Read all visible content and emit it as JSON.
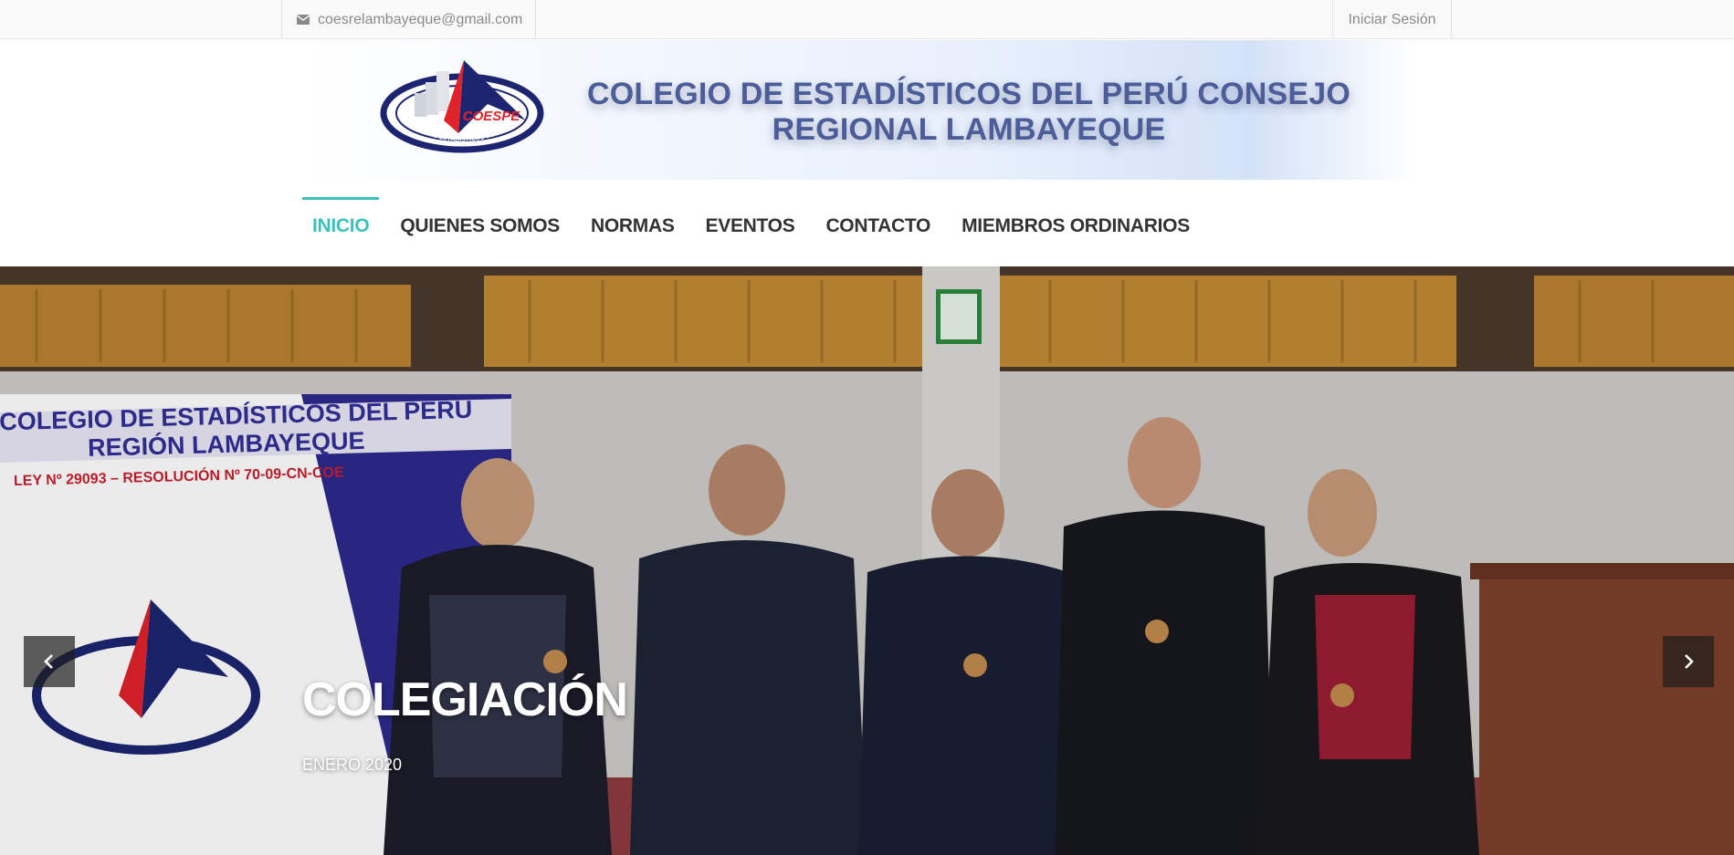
{
  "topbar": {
    "email": "coesrelambayeque@gmail.com",
    "email_icon": "envelope-icon",
    "login": "Iniciar Sesión"
  },
  "header": {
    "logo_text": "COESPE",
    "logo_ring_text": "COLEGIO DE ESTADÍSTICOS DEL PERÚ",
    "title_line1": "COLEGIO DE ESTADÍSTICOS DEL PERÚ CONSEJO",
    "title_line2": "REGIONAL LAMBAYEQUE"
  },
  "nav": {
    "items": [
      {
        "label": "INICIO",
        "active": true
      },
      {
        "label": "QUIENES SOMOS",
        "active": false
      },
      {
        "label": "NORMAS",
        "active": false
      },
      {
        "label": "EVENTOS",
        "active": false
      },
      {
        "label": "CONTACTO",
        "active": false
      },
      {
        "label": "MIEMBROS ORDINARIOS",
        "active": false
      }
    ]
  },
  "slider": {
    "title": "COLEGIACIÓN",
    "subtitle": "ENERO 2020",
    "banner_line1": "COLEGIO DE ESTADÍSTICOS DEL PERÚ",
    "banner_line2": "REGIÓN LAMBAYEQUE",
    "banner_line3": "LEY Nº 29093 – RESOLUCIÓN Nº 70-09-CN-COE",
    "prev_icon": "chevron-left-icon",
    "next_icon": "chevron-right-icon"
  },
  "colors": {
    "accent": "#3cc0bb",
    "title": "#4d5d99",
    "nav_text": "#333333",
    "topbar_text": "#8a8a8a"
  }
}
